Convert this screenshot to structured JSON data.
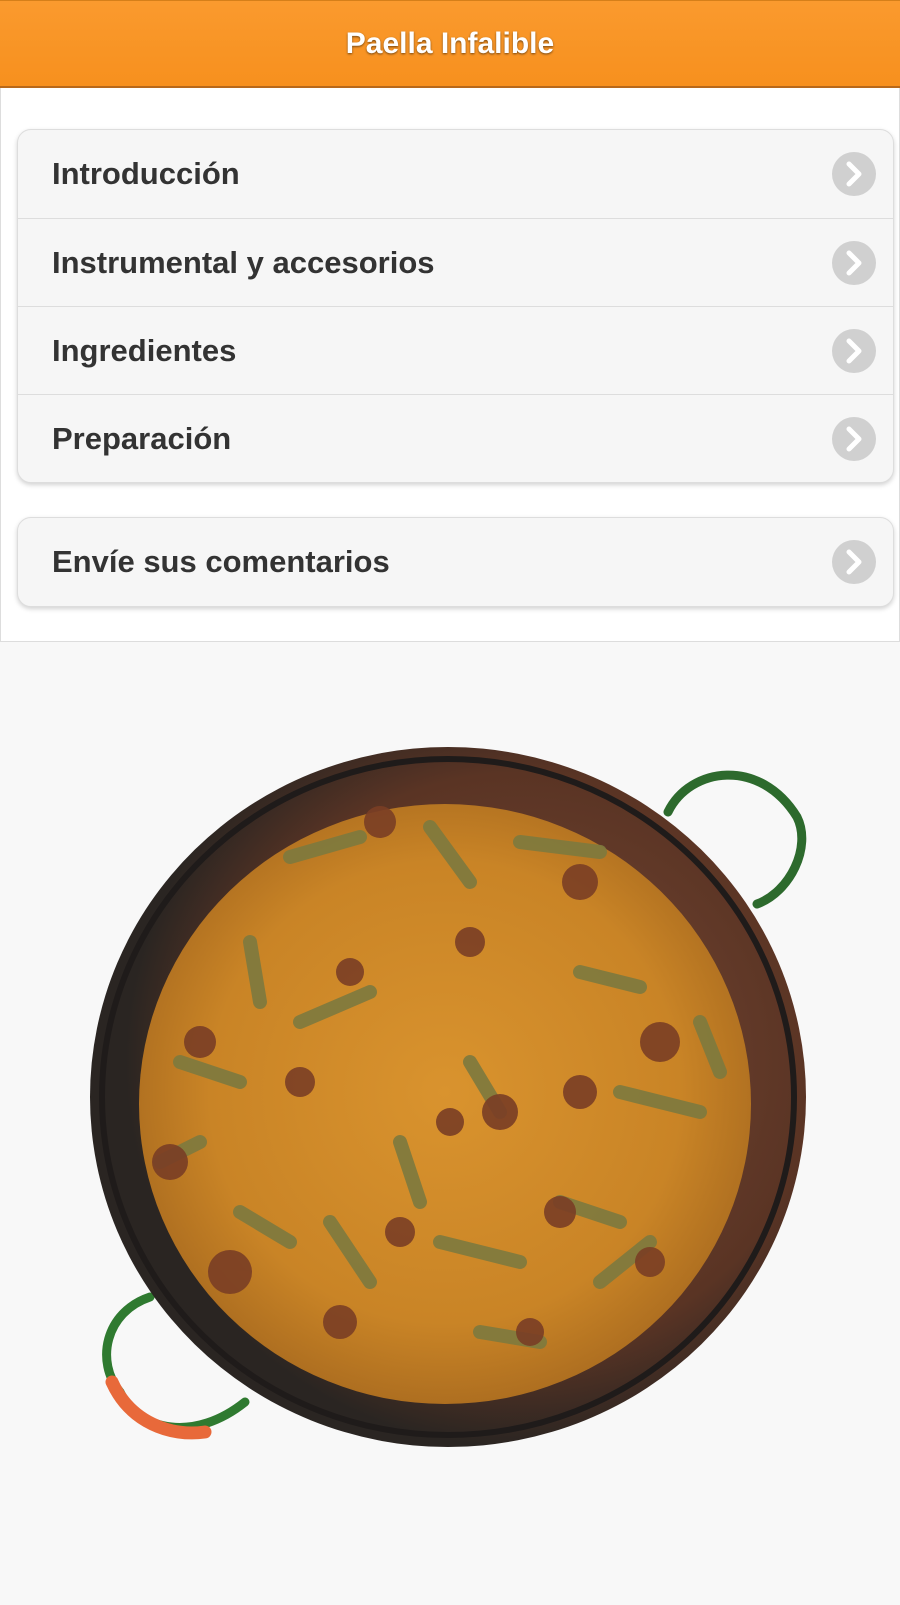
{
  "header": {
    "title": "Paella Infalible"
  },
  "menu": {
    "items": [
      {
        "label": "Introducción",
        "icon": "chevron-right-icon"
      },
      {
        "label": "Instrumental y accesorios",
        "icon": "chevron-right-icon"
      },
      {
        "label": "Ingredientes",
        "icon": "chevron-right-icon"
      },
      {
        "label": "Preparación",
        "icon": "chevron-right-icon"
      }
    ]
  },
  "feedback": {
    "label": "Envíe sus comentarios",
    "icon": "chevron-right-icon"
  },
  "image": {
    "subject": "paella-pan-image"
  },
  "colors": {
    "header": "#f7901e",
    "arrow": "#d0d0d0",
    "text": "#333333"
  }
}
